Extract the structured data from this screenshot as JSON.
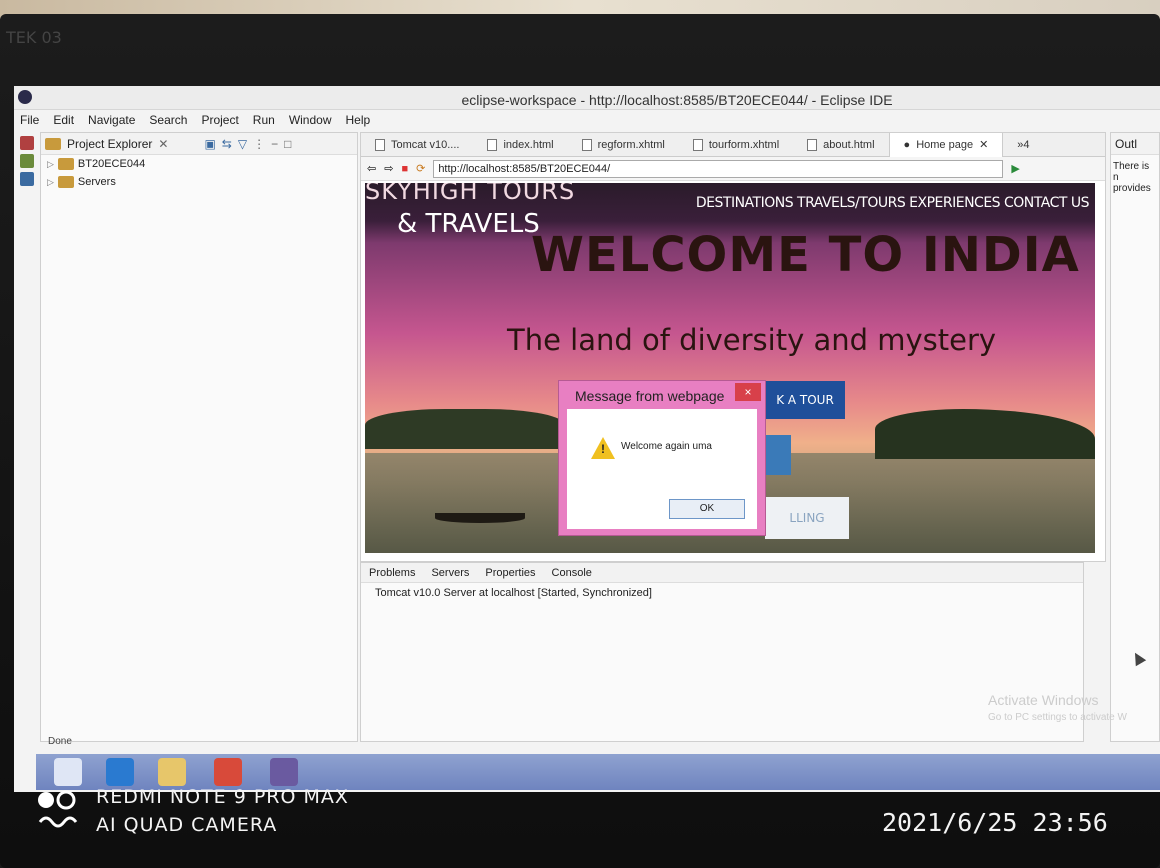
{
  "bezel_label": "TEK 03",
  "window": {
    "title": "eclipse-workspace - http://localhost:8585/BT20ECE044/ - Eclipse IDE"
  },
  "menu": [
    "File",
    "Edit",
    "Navigate",
    "Search",
    "Project",
    "Run",
    "Window",
    "Help"
  ],
  "explorer": {
    "title": "Project Explorer",
    "items": [
      {
        "label": "BT20ECE044"
      },
      {
        "label": "Servers"
      }
    ]
  },
  "editor": {
    "tabs": [
      "Tomcat v10....",
      "index.html",
      "regform.xhtml",
      "tourform.xhtml",
      "about.html",
      "Home page",
      "»4"
    ],
    "url": "http://localhost:8585/BT20ECE044/"
  },
  "webpage": {
    "brand_line1": "SKYHIGH TOURS",
    "brand_line2": "& TRAVELS",
    "nav": "DESTINATIONS TRAVELS/TOURS EXPERIENCES CONTACT US",
    "title": "WELCOME TO INDIA",
    "subtitle": "The land of diversity and mystery",
    "btn_book": "K A TOUR",
    "btn_other": "LLING"
  },
  "dialog": {
    "title": "Message from webpage",
    "message": "Welcome again uma",
    "ok": "OK",
    "close": "×"
  },
  "bottom_panel": {
    "tabs": [
      "Problems",
      "Servers",
      "Properties",
      "Console"
    ],
    "server_row": "Tomcat v10.0 Server at localhost  [Started, Synchronized]"
  },
  "outline": {
    "title": "Outl",
    "text1": "There is n",
    "text2": "provides"
  },
  "status": "Done",
  "activate": {
    "line1": "Activate Windows",
    "line2": "Go to PC settings to activate W"
  },
  "camera": {
    "model": "REDMI NOTE 9 PRO MAX",
    "camera": "AI QUAD CAMERA",
    "timestamp": "2021/6/25 23:56"
  }
}
